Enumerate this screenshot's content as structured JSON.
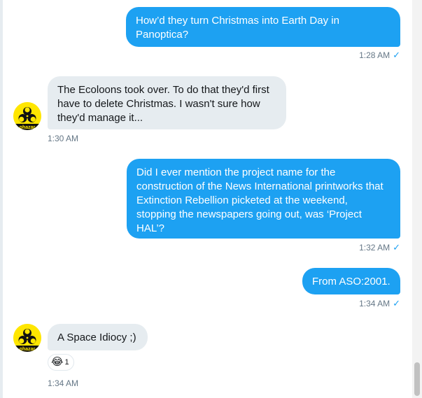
{
  "messages": [
    {
      "direction": "outgoing",
      "text": "How’d they turn Christmas into Earth Day in\nPanoptica?",
      "time": "1:28 AM"
    },
    {
      "direction": "incoming",
      "text": "The Ecoloons took over. To do that they'd first\nhave to delete Christmas. I wasn't sure how\nthey'd manage it...",
      "time": "1:30 AM"
    },
    {
      "direction": "outgoing",
      "text": "Did I ever mention the project name for the\nconstruction of the News International printworks that\nExtinction Rebellion picketed at the weekend,\nstopping the newspapers going out, was ‘Project\nHAL’?",
      "time": "1:32 AM"
    },
    {
      "direction": "outgoing",
      "text": "From ASO:2001.",
      "time": "1:34 AM"
    },
    {
      "direction": "incoming",
      "text": "A Space Idiocy ;)",
      "time": "1:34 AM",
      "reaction": {
        "emoji": "😂",
        "count": "1",
        "icon": "tears-of-joy-emoji-icon"
      }
    }
  ],
  "read_receipt": {
    "glyph": "✓",
    "icon": "sent-check-icon",
    "color": "#1da1f2"
  },
  "avatar": {
    "icon": "biohazard-avatar-icon",
    "label": "ohazar",
    "color": "#ffe600"
  },
  "colors": {
    "outgoing_bubble": "#1da1f2",
    "incoming_bubble": "#e6ecf0",
    "meta_text": "#657786"
  }
}
